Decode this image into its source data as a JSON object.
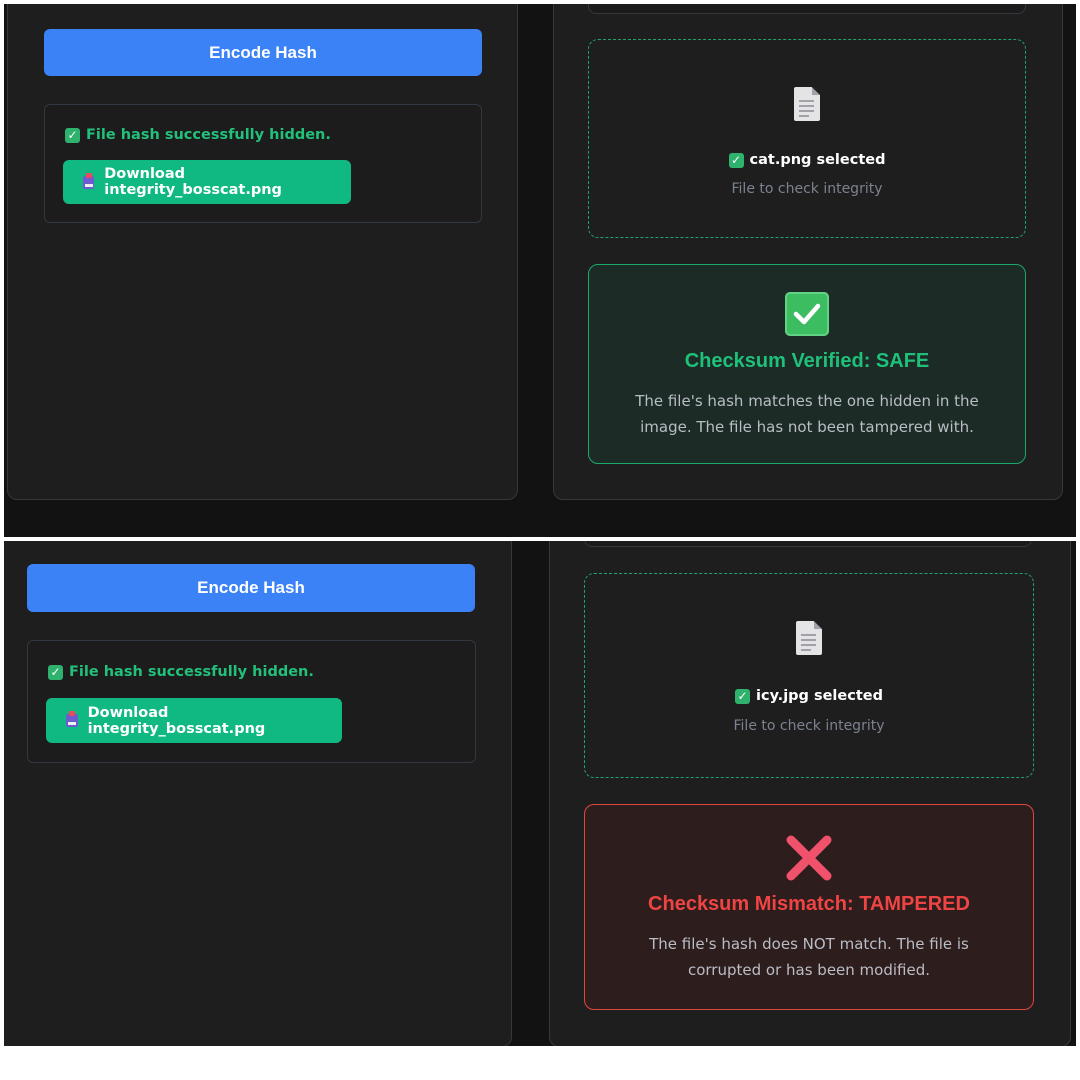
{
  "screens": [
    {
      "encode_button": "Encode Hash",
      "success_text": "File hash successfully hidden.",
      "download_button": "Download integrity_bosscat.png",
      "selected_file": "cat.png selected",
      "drop_hint": "File to check integrity",
      "result_title": "Checksum Verified: SAFE",
      "result_line1": "The file's hash matches the one hidden in the",
      "result_line2": "image. The file has not been tampered with.",
      "status": "safe"
    },
    {
      "encode_button": "Encode Hash",
      "success_text": "File hash successfully hidden.",
      "download_button": "Download integrity_bosscat.png",
      "selected_file": "icy.jpg selected",
      "drop_hint": "File to check integrity",
      "result_title": "Checksum Mismatch: TAMPERED",
      "result_line1": "The file's hash does NOT match. The file is",
      "result_line2": "corrupted or has been modified.",
      "status": "tampered"
    }
  ],
  "icons": {
    "success": "check-box-icon",
    "download": "inbox-tray-icon",
    "file": "document-icon",
    "selected": "check-box-icon",
    "safe": "white-check-mark-icon",
    "tampered": "cross-mark-icon"
  },
  "colors": {
    "background": "#121212",
    "panel": "#1e1e1e",
    "primary_button": "#3b82f6",
    "success": "#10b981",
    "success_text": "#22c07b",
    "danger": "#ef4444",
    "muted_text": "#7b8290"
  }
}
